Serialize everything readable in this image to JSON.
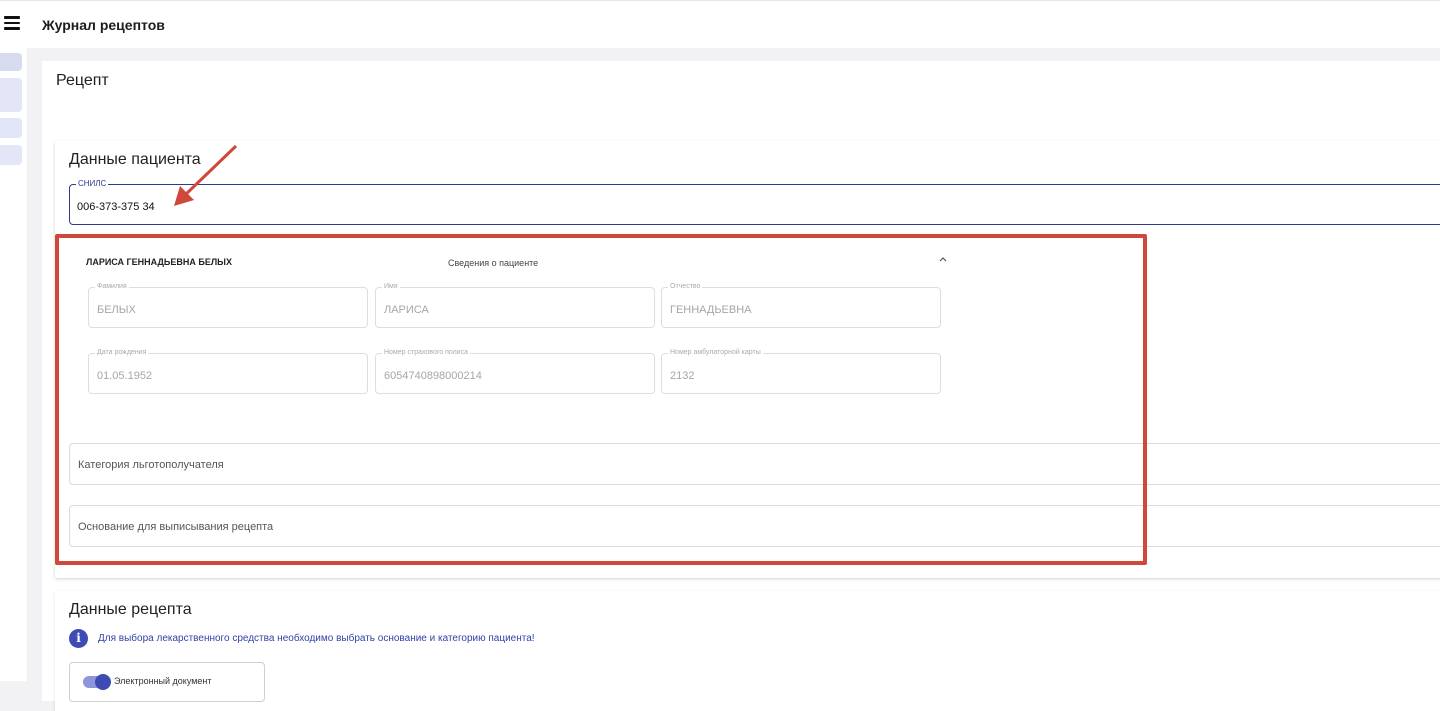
{
  "header": {
    "title": "Журнал рецептов",
    "menu_icon": "menu-icon"
  },
  "page": {
    "title": "Рецепт"
  },
  "patient_section": {
    "title": "Данные пациента",
    "snils": {
      "label": "СНИЛС",
      "value": "006-373-375 34"
    },
    "patient_name": "ЛАРИСА ГЕННАДЬЕВНА БЕЛЫХ",
    "info_label": "Сведения о пациенте",
    "fields": [
      {
        "label": "Фамилия",
        "value": "БЕЛЫХ"
      },
      {
        "label": "Имя",
        "value": "ЛАРИСА"
      },
      {
        "label": "Отчество",
        "value": "ГЕННАДЬЕВНА"
      },
      {
        "label": "Дата рождения",
        "value": "01.05.1952"
      },
      {
        "label": "Номер страхового полиса",
        "value": "6054740898000214"
      },
      {
        "label": "Номер амбулаторной карты",
        "value": "2132"
      }
    ],
    "category_placeholder": "Категория льготополучателя",
    "basis_placeholder": "Основание для выписывания рецепта"
  },
  "recipe_section": {
    "title": "Данные рецепта",
    "info_message": "Для выбора лекарственного средства необходимо выбрать основание и категорию пациента!",
    "edoc_label": "Электронный документ"
  },
  "colors": {
    "accent": "#3f4bb5",
    "annotation": "#d0483b"
  }
}
